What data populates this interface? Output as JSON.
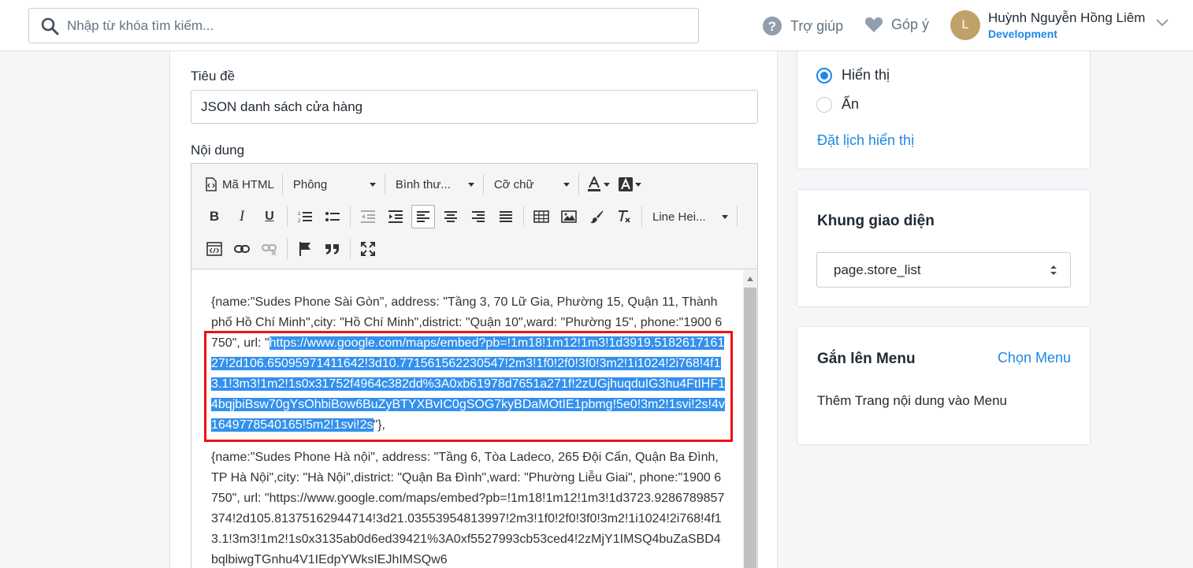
{
  "header": {
    "search_placeholder": "Nhập từ khóa tìm kiếm...",
    "help_label": "Trợ giúp",
    "feedback_label": "Góp ý",
    "user": {
      "initial": "L",
      "name": "Huỳnh Nguyễn Hồng Liêm",
      "store": "Development"
    }
  },
  "form": {
    "title_label": "Tiêu đề",
    "title_value": "JSON danh sách cửa hàng",
    "content_label": "Nội dung"
  },
  "toolbar": {
    "html_label": "Mã HTML",
    "font_label": "Phông",
    "style_label": "Bình thư...",
    "size_label": "Cỡ chữ",
    "line_height_label": "Line Hei..."
  },
  "content": {
    "p1_before": "{name:\"Sudes Phone Sài Gòn\", address: \"Tầng 3, 70 Lữ Gia, Phường 15, Quận 11, Thành phố Hồ Chí Minh\",city: \"Hồ Chí Minh\",district: \"Quận 10\",ward: \"Phường 15\", phone:\"1900 6750\", url: \"",
    "p1_selected": "https://www.google.com/maps/embed?pb=!1m18!1m12!1m3!1d3919.518261716127!2d106.6509597141164​2!3d10.771561562230547!2m3!1f0!2f0!3f0!3m2!1i1024!2i768!4f13.1!3m3!1m2!1s0x31752f4964c382dd%3A0xb61978d7651a271f!2zUGjhuqduIG3hu4FtIHF14bqjbiBsw70gYsOhbiBow6BuZyBTYXBvIC0gSOG7kyBDaMOtIE1pbmg!5e0!3m2!1svi!2s!4v1649778540165!5m2!1svi!2s",
    "p1_after": "\"},",
    "p2": "{name:\"Sudes Phone Hà nội\", address: \"Tầng 6, Tòa Ladeco, 265 Đội Cấn, Quận Ba Đình, TP Hà Nội\",city: \"Hà Nội\",district: \"Quận Ba Đình\",ward: \"Phường Liễu Giai\", phone:\"1900 6750\", url: \"https://www.google.com/maps/embed?pb=!1m18!1m12!1m3!1d3723.928678985737​4!2d105.81375162944714!3d21.03553954813997!2m3!1f0!2f0!3f0!3m2!1i1024!2i768!4f13.1!3m3!1m2!1s0x3135ab0d6ed39421%3A0xf5527993cb53ced4!2zMjY1IMSQ4buZaSBD4bqlbiwgTGnhu4V1IEdpYWksIEJhIMSQw6"
  },
  "visibility": {
    "show_label": "Hiển thị",
    "hide_label": "Ẩn",
    "schedule_link": "Đặt lịch hiển thị"
  },
  "template": {
    "title": "Khung giao diện",
    "selected": "page.store_list"
  },
  "menu": {
    "title": "Gắn lên Menu",
    "choose_link": "Chọn Menu",
    "description": "Thêm Trang nội dung vào Menu"
  },
  "colors": {
    "accent": "#1e88e5",
    "selection": "#3390ec",
    "highlight_border": "#ee1111"
  }
}
